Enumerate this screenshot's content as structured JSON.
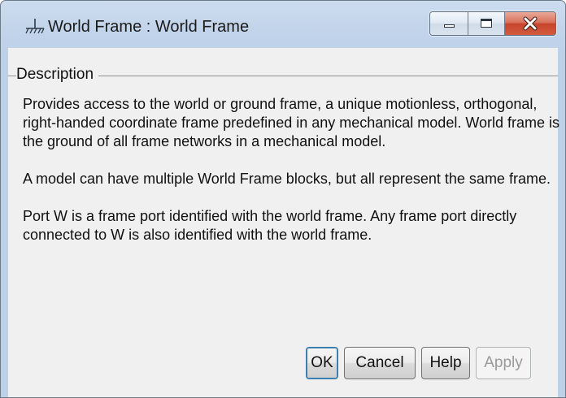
{
  "window": {
    "title": "World Frame : World Frame"
  },
  "group": {
    "title": "Description"
  },
  "description": {
    "paragraphs": [
      "Provides access to the world or ground frame, a unique motionless, orthogonal, right-handed coordinate frame predefined in any mechanical model. World frame is the ground of all frame networks in a mechanical model.",
      "A model can have multiple World Frame blocks, but all represent the same frame.",
      "Port W is a frame port identified with the world frame. Any frame port directly connected to W is also identified with the world frame."
    ]
  },
  "buttons": {
    "ok": "OK",
    "cancel": "Cancel",
    "help": "Help",
    "apply": "Apply",
    "apply_enabled": false
  },
  "colors": {
    "close_button": "#c7452c",
    "default_button_border": "#3c7fb1",
    "window_frame": "#c2d4ea"
  },
  "icons": {
    "app": "ground-symbol-icon",
    "minimize": "minimize-icon",
    "maximize": "maximize-icon",
    "close": "close-icon"
  }
}
